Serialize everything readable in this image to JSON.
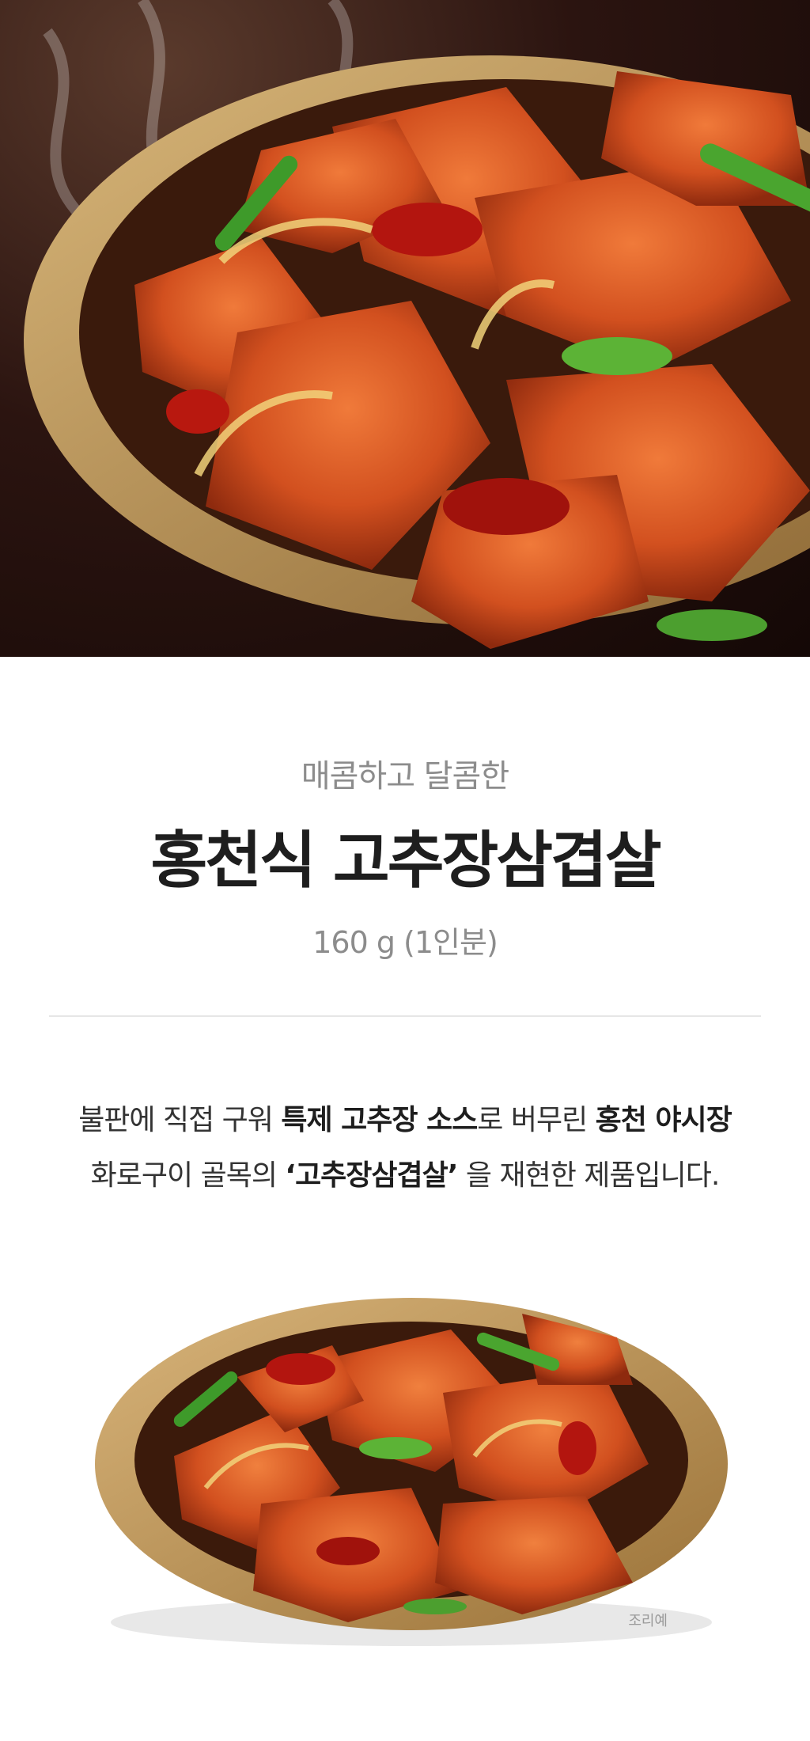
{
  "hero": {
    "image_desc_icon": "spicy-pork-belly-hero-photo"
  },
  "subtitle": "매콤하고 달콤한",
  "title": "홍천식 고추장삼겹살",
  "weight": "160 g (1인분)",
  "description": {
    "line1": {
      "part1": "불판에 직접 구워 ",
      "bold1": "특제 고추장 소스",
      "part2": "로 버무린 ",
      "bold2": "홍천 야시장"
    },
    "line2": {
      "part1": "화로구이 골목의 ",
      "bold1": "‘고추장삼겹살’",
      "part2": " 을 재현한 제품입니다."
    }
  },
  "caption": "조리예",
  "colors": {
    "background": "#ffffff",
    "title": "#1e1e1e",
    "muted": "#8c8c8c",
    "sauce": "#c2451c",
    "plate": "#c9a46a"
  }
}
